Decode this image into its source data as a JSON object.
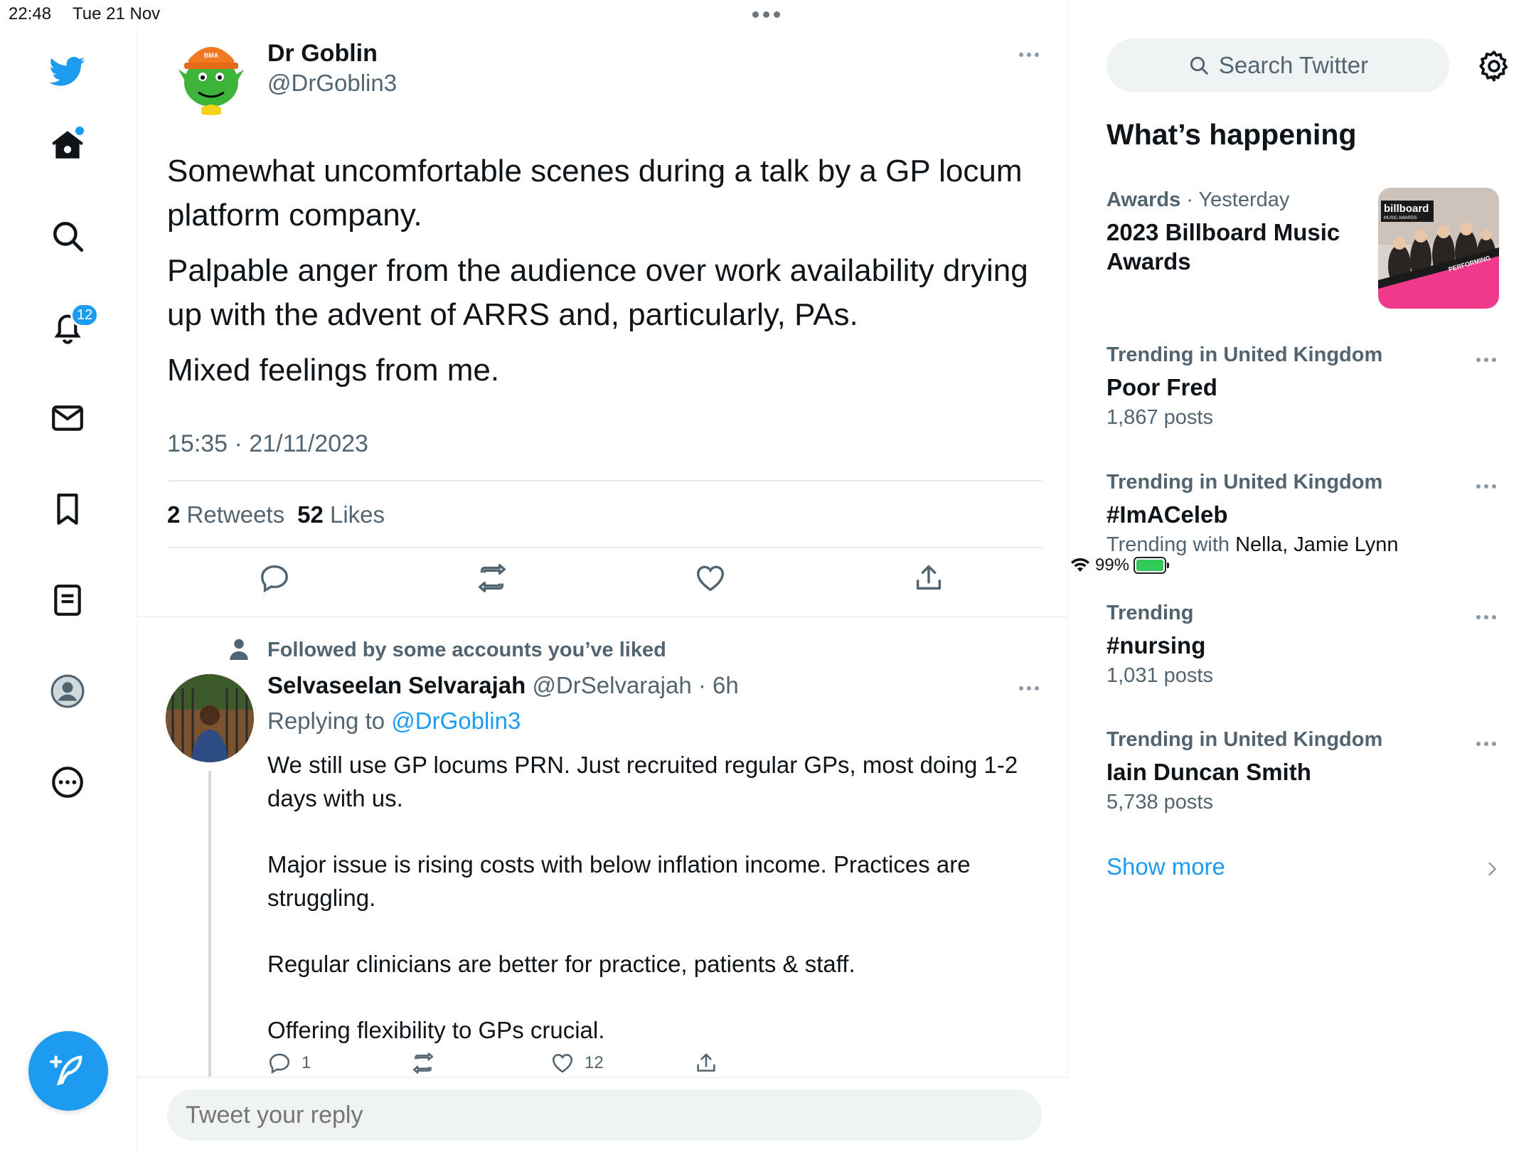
{
  "status_bar": {
    "time": "22:48",
    "date": "Tue 21 Nov",
    "battery": "99%",
    "battery_level": 0.99
  },
  "nav": {
    "notifications_badge": "12",
    "items": [
      "twitter-logo",
      "home-icon",
      "search-icon",
      "bell-icon",
      "mail-icon",
      "bookmark-icon",
      "lists-icon",
      "profile-icon",
      "more-icon"
    ]
  },
  "tweet": {
    "author_name": "Dr Goblin",
    "author_handle": "@DrGoblin3",
    "paragraphs": [
      "Somewhat uncomfortable scenes during a talk by a GP locum platform company.",
      "Palpable anger from the audience over work availability drying up with the advent of ARRS and, particularly, PAs.",
      "Mixed feelings from me."
    ],
    "timestamp": "15:35 · 21/11/2023",
    "retweets_count": "2",
    "retweets_label": "Retweets",
    "likes_count": "52",
    "likes_label": "Likes",
    "avatar_badge": "BMA"
  },
  "reply": {
    "social_context": "Followed by some accounts you’ve liked",
    "name": "Selvaseelan Selvarajah",
    "handle_meta": "@DrSelvarajah · 6h",
    "replying_label": "Replying to",
    "replying_to": "@DrGoblin3",
    "paragraphs": [
      "We still use GP locums PRN. Just recruited regular GPs, most doing 1-2 days with us.",
      "Major issue is rising costs with below inflation income. Practices are struggling.",
      "Regular clinicians are better for practice, patients & staff.",
      "Offering flexibility to GPs crucial."
    ],
    "reply_count": "1",
    "like_count": "12"
  },
  "reply_bar": {
    "placeholder": "Tweet your reply"
  },
  "sidebar": {
    "search_placeholder": "Search Twitter",
    "whats_happening": "What’s happening",
    "trends": [
      {
        "context": "Awards",
        "context_extra": " · Yesterday",
        "title": "2023 Billboard Music Awards"
      },
      {
        "context": "Trending in United Kingdom",
        "title": "Poor Fred",
        "count": "1,867 posts"
      },
      {
        "context": "Trending in United Kingdom",
        "title": "#ImACeleb",
        "count_prefix": "Trending with ",
        "count_names": "Nella, Jamie Lynn"
      },
      {
        "context": "Trending",
        "title": "#nursing",
        "count": "1,031 posts"
      },
      {
        "context": "Trending in United Kingdom",
        "title": "Iain Duncan Smith",
        "count": "5,738 posts"
      }
    ],
    "billboard_logo": "billboard",
    "billboard_sub": "MUSIC AWARDS",
    "billboard_banner": "PERFORMING",
    "show_more": "Show more"
  },
  "colors": {
    "accent": "#1d9bf0",
    "text": "#0f1419",
    "secondary": "#536471",
    "divider": "#eff3f4"
  }
}
